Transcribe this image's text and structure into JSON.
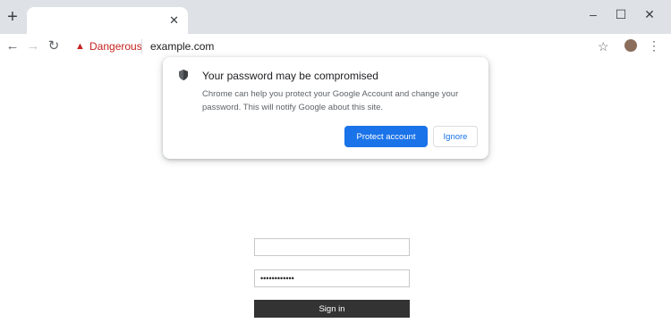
{
  "browser": {
    "new_tab_icon": "plus-icon",
    "tab": {
      "title": "",
      "close_icon": "close-icon"
    },
    "window_controls": [
      "minimize-icon",
      "maximize-icon",
      "close-icon"
    ],
    "toolbar": {
      "icons": [
        "back-arrow-icon",
        "forward-arrow-icon",
        "reload-icon"
      ],
      "security_label": "Dangerous",
      "url": "example.com",
      "right_icons": [
        "star-icon",
        "avatar-icon",
        "more-menu-icon"
      ]
    }
  },
  "bubble": {
    "icon": "shield-icon",
    "title": "Your password may be compromised",
    "body": "Chrome can help you protect your Google Account and change your password. This will notify Google about this site.",
    "primary_label": "Protect account",
    "secondary_label": "Ignore"
  },
  "login": {
    "username_value": "",
    "password_value": "••••••••••••",
    "signin_label": "Sign in"
  },
  "colors": {
    "accent": "#1a73e8",
    "danger": "#c5221f",
    "tabstrip": "#dee1e6",
    "signin_bg": "#333333"
  }
}
